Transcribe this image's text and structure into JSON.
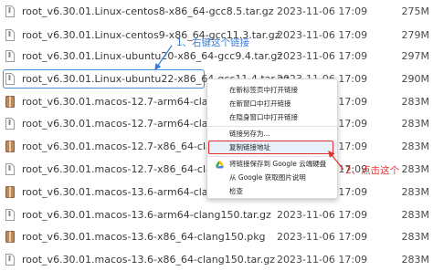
{
  "files": [
    {
      "name": "root_v6.30.01.Linux-centos8-x86_64-gcc8.5.tar.gz",
      "date": "2023-11-06 17:09",
      "size": "275M",
      "highlighted": false
    },
    {
      "name": "root_v6.30.01.Linux-centos9-x86_64-gcc11.3.tar.gz",
      "date": "2023-11-06 17:09",
      "size": "279M",
      "highlighted": false
    },
    {
      "name": "root_v6.30.01.Linux-ubuntu20-x86_64-gcc9.4.tar.gz",
      "date": "2023-11-06 17:09",
      "size": "297M",
      "highlighted": false
    },
    {
      "name": "root_v6.30.01.Linux-ubuntu22-x86_64-gcc11.4.tar.gz",
      "date": "2023-11-06 17:09",
      "size": "290M",
      "highlighted": true
    },
    {
      "name": "root_v6.30.01.macos-12.7-arm64-clang140.pkg",
      "date": "2023-11-06 17:09",
      "size": "283M",
      "highlighted": false
    },
    {
      "name": "root_v6.30.01.macos-12.7-arm64-clang140.tar.gz",
      "date": "2023-11-06 17:09",
      "size": "283M",
      "highlighted": false
    },
    {
      "name": "root_v6.30.01.macos-12.7-x86_64-clang140.pkg",
      "date": "2023-11-06 17:09",
      "size": "283M",
      "highlighted": false
    },
    {
      "name": "root_v6.30.01.macos-12.7-x86_64-clang140.tar.gz",
      "date": "2023-11-06 17:09",
      "size": "283M",
      "highlighted": false
    },
    {
      "name": "root_v6.30.01.macos-13.6-arm64-clang150.pkg",
      "date": "2023-11-06 17:09",
      "size": "283M",
      "highlighted": false
    },
    {
      "name": "root_v6.30.01.macos-13.6-arm64-clang150.tar.gz",
      "date": "2023-11-06 17:09",
      "size": "283M",
      "highlighted": false
    },
    {
      "name": "root_v6.30.01.macos-13.6-x86_64-clang150.pkg",
      "date": "2023-11-06 17:09",
      "size": "283M",
      "highlighted": false
    },
    {
      "name": "root_v6.30.01.macos-13.6-x86_64-clang150.tar.gz",
      "date": "2023-11-06 17:09",
      "size": "283M",
      "highlighted": false
    }
  ],
  "context_menu": {
    "items": [
      {
        "label": "在新标签页中打开链接",
        "icon": "",
        "separator_after": false,
        "selected": false
      },
      {
        "label": "在新窗口中打开链接",
        "icon": "",
        "separator_after": false,
        "selected": false
      },
      {
        "label": "在隐身窗口中打开链接",
        "icon": "",
        "separator_after": true,
        "selected": false
      },
      {
        "label": "链接另存为...",
        "icon": "",
        "separator_after": false,
        "selected": false
      },
      {
        "label": "复制链接地址",
        "icon": "",
        "separator_after": true,
        "selected": true
      },
      {
        "label": "将链接保存到 Google 云端硬盘",
        "icon": "google-drive-icon",
        "separator_after": false,
        "selected": false
      },
      {
        "label": "从 Google 获取图片说明",
        "icon": "",
        "separator_after": false,
        "selected": false
      },
      {
        "label": "检查",
        "icon": "",
        "separator_after": false,
        "selected": false
      }
    ]
  },
  "annotations": {
    "step1": "1、右键这个链接",
    "step2": "2、点击这个"
  },
  "colors": {
    "tar_icon": "#b0b0b0",
    "pkg_icon": "#9a6f4a",
    "highlight_border": "#4a90d9",
    "annotation_blue": "#3a7bd5",
    "annotation_red": "#e0302d"
  }
}
